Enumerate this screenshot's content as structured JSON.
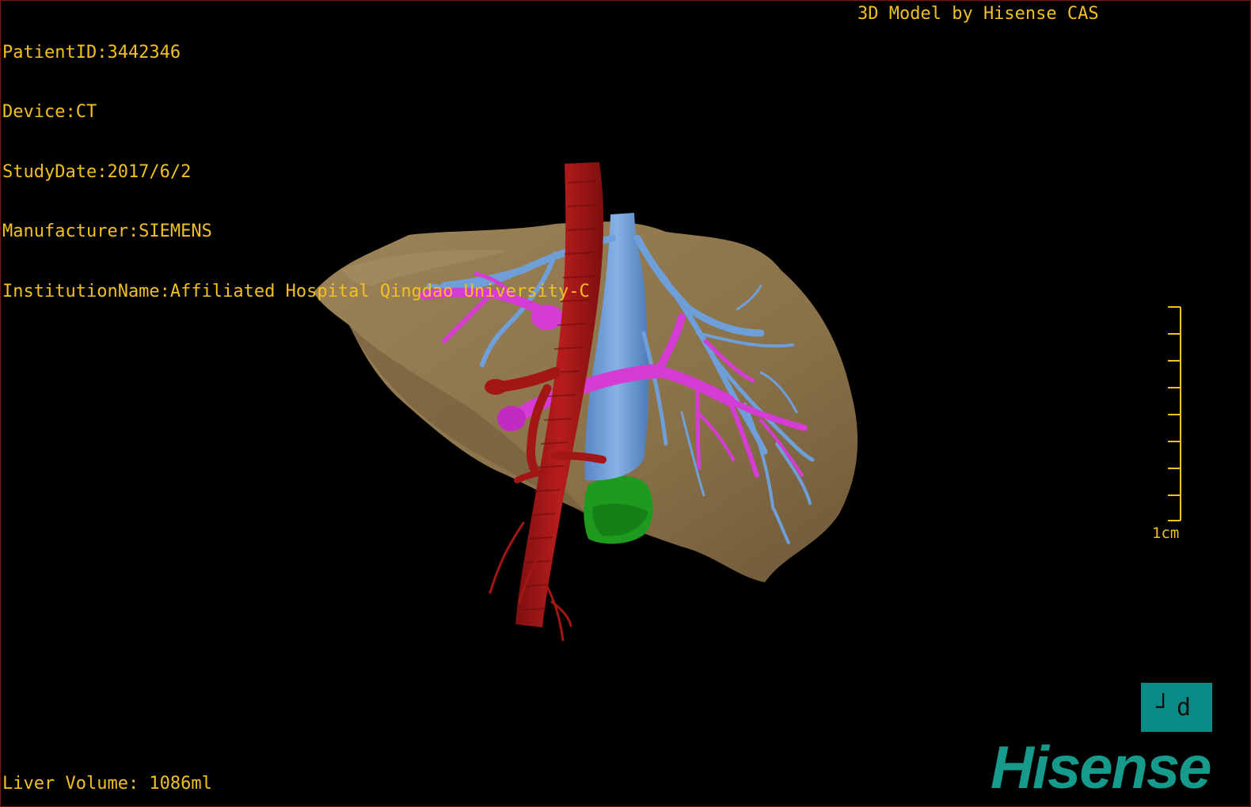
{
  "dicom_info": {
    "patient_id": "PatientID:3442346",
    "device": "Device:CT",
    "study_date": "StudyDate:2017/6/2",
    "manufacturer": "Manufacturer:SIEMENS",
    "institution": "InstitutionName:Affiliated Hospital Qingdao University-C"
  },
  "model_credit": "3D Model by Hisense CAS",
  "liver_volume": "Liver Volume: 1086ml",
  "scale": {
    "label": "1cm"
  },
  "orientation": {
    "label": "┘d"
  },
  "brand": {
    "name": "Hisense"
  },
  "colors": {
    "overlay_text": "#f2c020",
    "liver": "#8a7148",
    "artery": "#a31616",
    "portal_vein": "#d43cd4",
    "hepatic_vein": "#6f9fd8",
    "gallbladder": "#1e9a1e",
    "brand_teal": "#159a8c"
  }
}
